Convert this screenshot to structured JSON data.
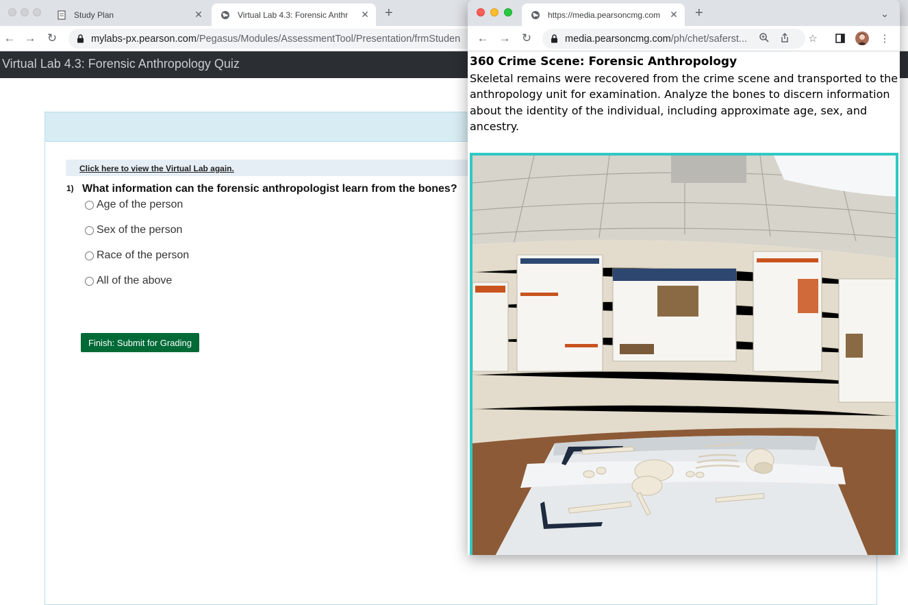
{
  "back_window": {
    "tabs": [
      {
        "title": "Study Plan",
        "icon": "document-icon"
      },
      {
        "title": "Virtual Lab 4.3: Forensic Anthr",
        "icon": "globe-icon"
      }
    ],
    "url_host": "mylabs-px.pearson.com",
    "url_path": "/Pegasus/Modules/AssessmentTool/Presentation/frmStuden",
    "app_title": "Virtual Lab 4.3: Forensic Anthropology Quiz",
    "quiz": {
      "lab_link": "Click here to view the Virtual Lab again.",
      "question_number": "1)",
      "question": "What information can the forensic anthropologist learn from the bones?",
      "choices": [
        "Age of the person",
        "Sex of the person",
        "Race of the person",
        "All of the above"
      ],
      "submit_label": "Finish: Submit for Grading"
    }
  },
  "front_window": {
    "tab_title": "https://media.pearsoncmg.com",
    "url_host": "media.pearsoncmg.com",
    "url_path": "/ph/chet/saferst...",
    "page": {
      "title": "360 Crime Scene: Forensic Anthropology",
      "description": "Skeletal remains were recovered from the crime scene and transported to the anthropology unit for examination. Analyze the bones to discern information about the identity of the individual, including approximate age, sex, and ancestry."
    }
  },
  "colors": {
    "app_bar": "#2b2f33",
    "submit": "#006a37",
    "pano_border": "#2fc9c4"
  }
}
